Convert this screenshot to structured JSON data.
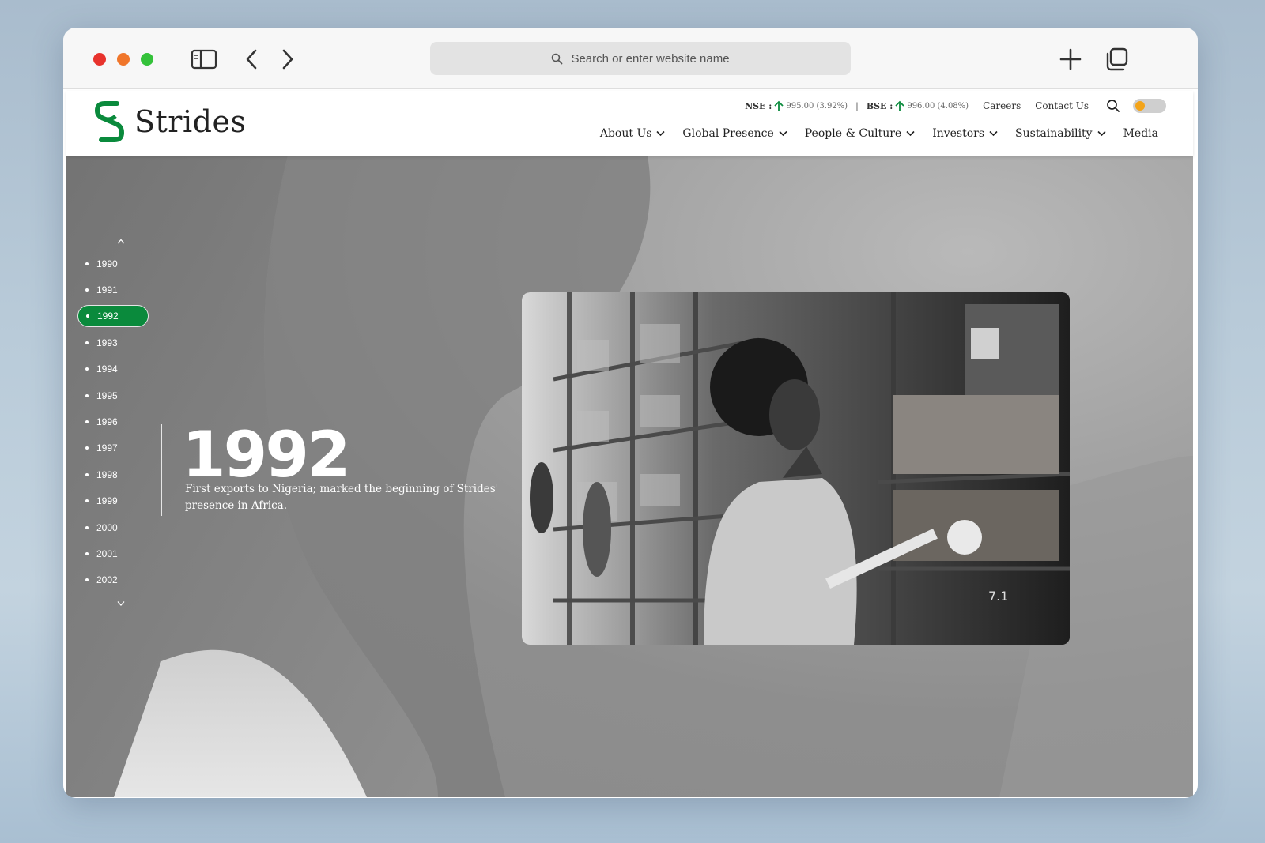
{
  "browser": {
    "address_placeholder": "Search or enter website name"
  },
  "site": {
    "logo_text": "Strides",
    "ticker": {
      "nse_label": "NSE :",
      "nse_value": "995.00 (3.92%)",
      "separator": "|",
      "bse_label": "BSE :",
      "bse_value": "996.00 (4.08%)"
    },
    "top_links": {
      "careers": "Careers",
      "contact": "Contact Us"
    },
    "nav": [
      {
        "label": "About Us"
      },
      {
        "label": "Global Presence"
      },
      {
        "label": "People & Culture"
      },
      {
        "label": "Investors"
      },
      {
        "label": "Sustainability"
      },
      {
        "label": "Media"
      }
    ]
  },
  "timeline": {
    "years": [
      "1990",
      "1991",
      "1992",
      "1993",
      "1994",
      "1995",
      "1996",
      "1997",
      "1998",
      "1999",
      "2000",
      "2001",
      "2002"
    ],
    "active_year": "1992",
    "feature_year": "1992",
    "feature_desc": "First exports to Nigeria; marked the beginning of Strides' presence in Africa."
  },
  "colors": {
    "brand_green": "#0a8a3c",
    "ticker_up": "#0a8a3c",
    "toggle_knob": "#f3a41a"
  },
  "icons": {
    "sidebar": "sidebar-icon",
    "back": "chevron-left-icon",
    "forward": "chevron-right-icon",
    "search": "search-icon",
    "new_tab": "plus-icon",
    "tabs": "tabs-overview-icon",
    "ticker_up": "arrow-up-icon",
    "nav_dropdown": "chevron-down-icon"
  }
}
